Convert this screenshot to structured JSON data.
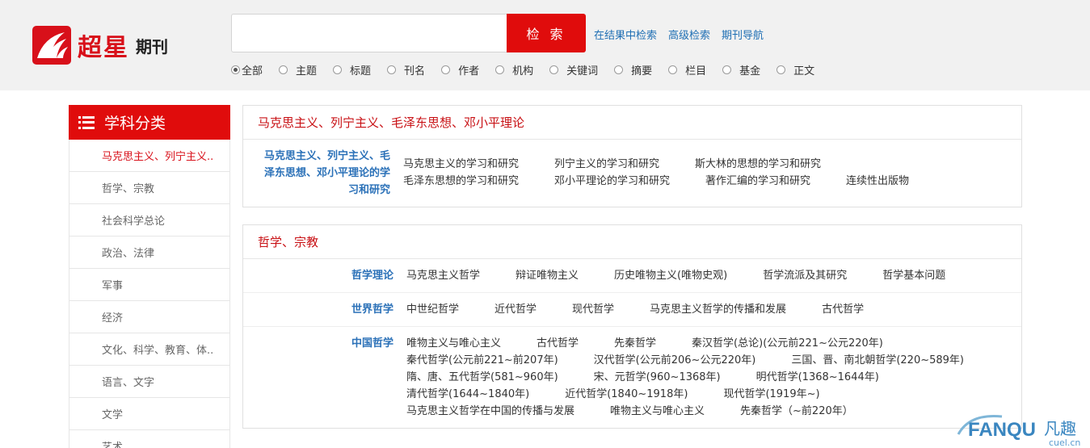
{
  "header": {
    "logo_text": "超星",
    "logo_sub": "期刊",
    "search_placeholder": "",
    "search_button": "检 索",
    "links": [
      "在结果中检索",
      "高级检索",
      "期刊导航"
    ],
    "radio_options": [
      "全部",
      "主题",
      "标题",
      "刊名",
      "作者",
      "机构",
      "关键词",
      "摘要",
      "栏目",
      "基金",
      "正文"
    ],
    "radio_selected": "全部"
  },
  "sidebar": {
    "title": "学科分类",
    "items": [
      "马克思主义、列宁主义..",
      "哲学、宗教",
      "社会科学总论",
      "政治、法律",
      "军事",
      "经济",
      "文化、科学、教育、体..",
      "语言、文字",
      "文学",
      "艺术"
    ]
  },
  "panels": [
    {
      "title": "马克思主义、列宁主义、毛泽东思想、邓小平理论",
      "rows": [
        {
          "label": "马克思主义、列宁主义、毛泽东思想、邓小平理论的学习和研究",
          "items": [
            "马克思主义的学习和研究",
            "列宁主义的学习和研究",
            "斯大林的思想的学习和研究",
            "毛泽东思想的学习和研究",
            "邓小平理论的学习和研究",
            "著作汇编的学习和研究",
            "连续性出版物"
          ]
        }
      ]
    },
    {
      "title": "哲学、宗教",
      "rows": [
        {
          "label": "哲学理论",
          "items": [
            "马克思主义哲学",
            "辩证唯物主义",
            "历史唯物主义(唯物史观)",
            "哲学流派及其研究",
            "哲学基本问题"
          ]
        },
        {
          "label": "世界哲学",
          "items": [
            "中世纪哲学",
            "近代哲学",
            "现代哲学",
            "马克思主义哲学的传播和发展",
            "古代哲学"
          ]
        },
        {
          "label": "中国哲学",
          "items": [
            "唯物主义与唯心主义",
            "古代哲学",
            "先秦哲学",
            "秦汉哲学(总论)(公元前221~公元220年)",
            "秦代哲学(公元前221~前207年)",
            "汉代哲学(公元前206~公元220年)",
            "三国、晋、南北朝哲学(220~589年)",
            "隋、唐、五代哲学(581~960年)",
            "宋、元哲学(960~1368年)",
            "明代哲学(1368~1644年)",
            "清代哲学(1644~1840年)",
            "近代哲学(1840~1918年)",
            "现代哲学(1919年~)",
            "马克思主义哲学在中国的传播与发展",
            "唯物主义与唯心主义",
            "先秦哲学（~前220年）"
          ]
        }
      ]
    }
  ],
  "watermark": {
    "text": "FANQU",
    "text2": "凡趣",
    "sub": "cuel.cn"
  },
  "colors": {
    "brand_red": "#e00c0c",
    "link_blue": "#1f6fb4",
    "label_blue": "#2b71b8"
  }
}
